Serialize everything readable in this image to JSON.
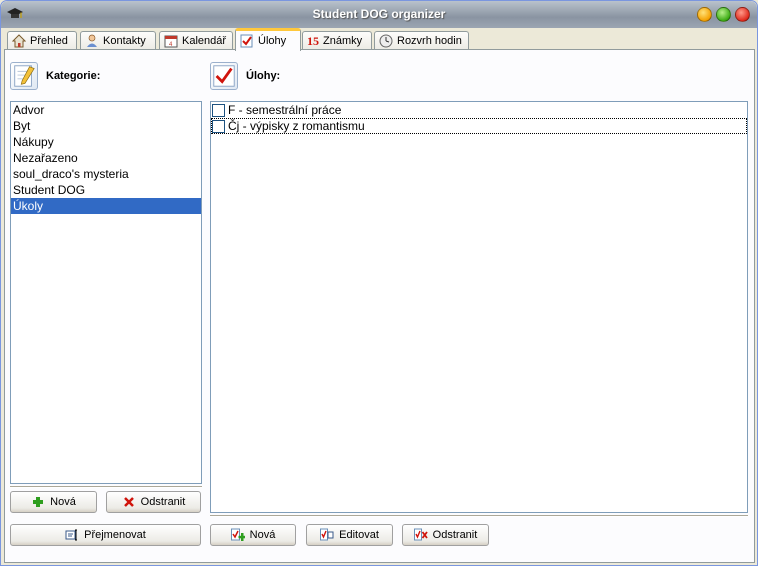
{
  "window": {
    "title": "Student DOG organizer"
  },
  "tabs": [
    {
      "label": "Přehled",
      "icon": "home-icon"
    },
    {
      "label": "Kontakty",
      "icon": "contacts-icon"
    },
    {
      "label": "Kalendář",
      "icon": "calendar-icon"
    },
    {
      "label": "Úlohy",
      "icon": "task-check-icon",
      "active": true
    },
    {
      "label": "Známky",
      "icon": "grades-icon",
      "icon_text": "15"
    },
    {
      "label": "Rozvrh hodin",
      "icon": "clock-icon"
    }
  ],
  "categories": {
    "label": "Kategorie:",
    "items": [
      "Advor",
      "Byt",
      "Nákupy",
      "Nezařazeno",
      "soul_draco's mysteria",
      "Student DOG",
      "Úkoly"
    ],
    "selected_index": 6,
    "buttons": {
      "new": "Nová",
      "remove": "Odstranit",
      "rename": "Přejmenovat"
    }
  },
  "tasks": {
    "label": "Úlohy:",
    "items": [
      {
        "text": "F - semestrální práce",
        "checked": false
      },
      {
        "text": "Čj - výpisky z romantismu",
        "checked": false
      }
    ],
    "focused_index": 1,
    "buttons": {
      "new": "Nová",
      "edit": "Editovat",
      "remove": "Odstranit"
    }
  },
  "colors": {
    "selection": "#316ac5",
    "active_tab_accent": "#ffc83c",
    "add_green": "#2e9e1e",
    "remove_red": "#d0140c"
  }
}
